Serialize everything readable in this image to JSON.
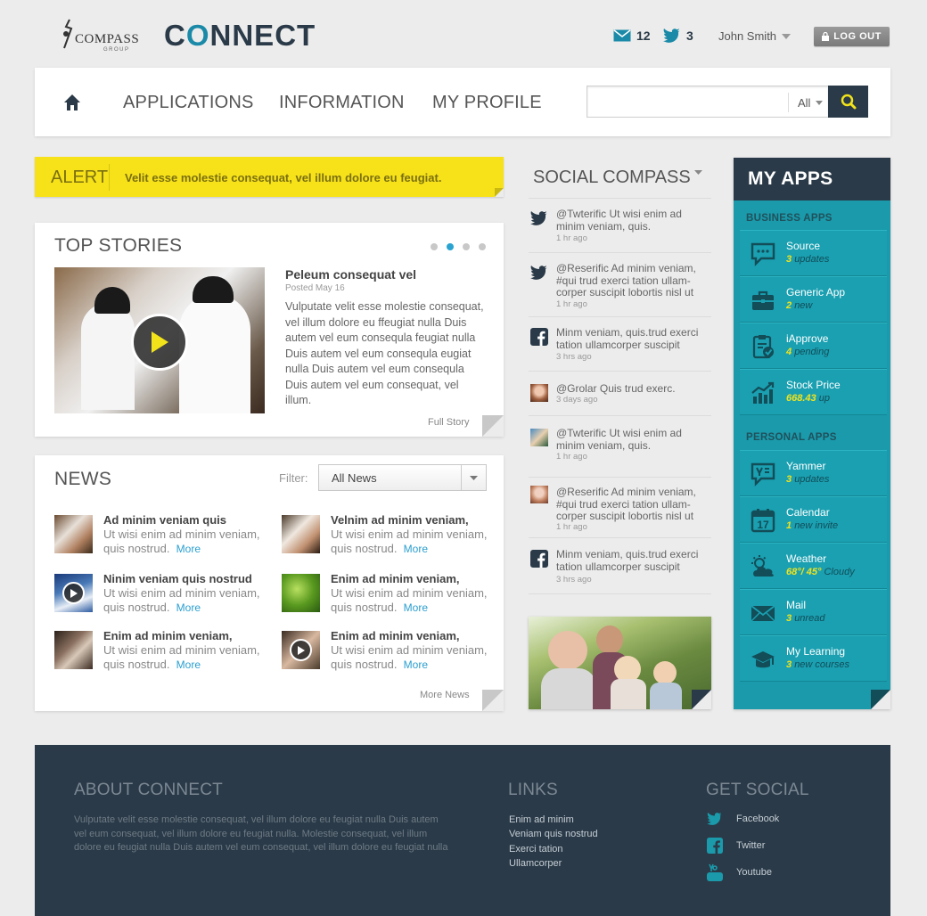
{
  "header": {
    "brand": "COMPASS",
    "brand_sub": "GROUP",
    "app_name_pre": "C",
    "app_name_o": "O",
    "app_name_post": "NNECT",
    "mail_count": "12",
    "twitter_count": "3",
    "user_name": "John Smith",
    "logout_label": "LOG OUT"
  },
  "nav": {
    "items": [
      "APPLICATIONS",
      "INFORMATION",
      "MY PROFILE"
    ],
    "search_placeholder": "",
    "search_scope": "All"
  },
  "alert": {
    "label": "ALERT",
    "message": "Velit esse molestie consequat, vel illum dolore eu feugiat."
  },
  "top_stories": {
    "title": "TOP STORIES",
    "headline": "Peleum consequat vel",
    "date": "Posted May 16",
    "body": "Vulputate velit esse molestie consequat, vel illum dolore eu ffeugiat nulla Duis autem vel eum consequla feugiat nulla Duis autem vel eum consequla eugiat nulla Duis autem vel eum consequla Duis autem vel eum consequat, vel illum.",
    "link": "Full Story"
  },
  "news": {
    "title": "NEWS",
    "filter_label": "Filter:",
    "filter_value": "All News",
    "more_label": "More",
    "more_news": "More News",
    "items": [
      {
        "title": "Ad minim veniam quis",
        "text": "Ut wisi enim ad minim veniam, quis nostrud."
      },
      {
        "title": "Velnim ad minim veniam,",
        "text": "Ut wisi enim ad minim veniam, quis nostrud."
      },
      {
        "title": "Ninim veniam quis nostrud",
        "text": "Ut wisi enim ad minim veniam, quis nostrud."
      },
      {
        "title": "Enim ad minim veniam,",
        "text": "Ut wisi enim ad minim veniam, quis nostrud."
      },
      {
        "title": "Enim ad minim veniam,",
        "text": "Ut wisi enim ad minim veniam, quis nostrud."
      },
      {
        "title": "Enim ad minim veniam,",
        "text": "Ut wisi enim ad minim veniam, quis nostrud."
      }
    ]
  },
  "social": {
    "title": "SOCIAL COMPASS",
    "items": [
      {
        "icon": "twitter-icon",
        "text": "@Twterific Ut wisi enim ad minim veniam, quis.",
        "time": "1 hr ago"
      },
      {
        "icon": "twitter-icon",
        "text": "@Reserific Ad minim veniam, #qui trud exerci tation ullam-corper suscipit lobortis nisl ut",
        "time": "1 hr ago"
      },
      {
        "icon": "facebook-icon",
        "text": "Minm veniam, quis.trud exerci tation ullamcorper suscipit",
        "time": "3 hrs ago"
      },
      {
        "icon": "avatar",
        "text": "@Grolar Quis trud exerc.",
        "time": "3 days ago"
      },
      {
        "icon": "avatar",
        "text": "@Twterific Ut wisi enim ad minim veniam, quis.",
        "time": "1 hr ago"
      },
      {
        "icon": "avatar",
        "text": "@Reserific Ad minim veniam, #qui trud exerci tation ullam-corper suscipit lobortis nisl ut",
        "time": "1 hr ago"
      },
      {
        "icon": "facebook-icon",
        "text": "Minm veniam, quis.trud exerci tation ullamcorper suscipit",
        "time": "3 hrs ago"
      }
    ]
  },
  "my_apps": {
    "title": "MY APPS",
    "business_label": "BUSINESS APPS",
    "personal_label": "PERSONAL APPS",
    "business": [
      {
        "name": "Source",
        "count": "3",
        "status": "updates",
        "icon": "chat-icon"
      },
      {
        "name": "Generic App",
        "count": "2",
        "status": "new",
        "icon": "briefcase-icon"
      },
      {
        "name": "iApprove",
        "count": "4",
        "status": "pending",
        "icon": "clipboard-check-icon"
      },
      {
        "name": "Stock Price",
        "count": "668.43",
        "status": "up",
        "icon": "chart-icon"
      }
    ],
    "personal": [
      {
        "name": "Yammer",
        "count": "3",
        "status": "updates",
        "icon": "yammer-icon"
      },
      {
        "name": "Calendar",
        "count": "1",
        "status": "new invite",
        "icon": "calendar-icon"
      },
      {
        "name": "Weather",
        "count": "68°/ 45°",
        "status": "Cloudy",
        "icon": "weather-icon"
      },
      {
        "name": "Mail",
        "count": "3",
        "status": "unread",
        "icon": "mail-icon"
      },
      {
        "name": "My Learning",
        "count": "3",
        "status": "new courses",
        "icon": "graduation-icon"
      }
    ]
  },
  "footer": {
    "about_title": "ABOUT CONNECT",
    "about_text": "Vulputate velit esse molestie consequat, vel illum dolore eu feugiat nulla Duis autem vel eum consequat, vel illum dolore eu feugiat nulla.  Molestie consequat, vel illum dolore eu feugiat nulla Duis autem vel eum consequat, vel illum dolore eu feugiat nulla",
    "links_title": "LINKS",
    "links": [
      "Enim ad minim",
      "Veniam quis nostrud",
      "Exerci tation",
      "Ullamcorper"
    ],
    "social_title": "GET SOCIAL",
    "social": [
      "Facebook",
      "Twitter",
      "Youtube"
    ]
  },
  "colors": {
    "accent": "#1a9aab",
    "navy": "#2a3a48",
    "alert": "#f7e21a",
    "link": "#2a9fd0",
    "highlight": "#f2e31b"
  }
}
